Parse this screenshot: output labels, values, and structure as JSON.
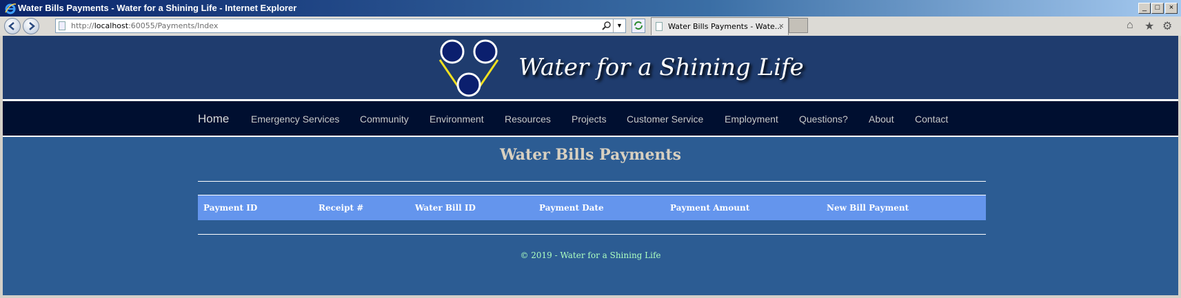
{
  "window": {
    "title": "Water Bills Payments - Water for a Shining Life - Internet Explorer",
    "buttons": [
      "_",
      "□",
      "×"
    ]
  },
  "browser": {
    "url_prefix": "http://",
    "url_host": "localhost",
    "url_rest": ":60055/Payments/Index",
    "tab_label": "Water Bills Payments - Wate...",
    "tab_close": "×",
    "tools": [
      "⌂",
      "★",
      "⚙"
    ]
  },
  "site": {
    "brand": "Water for a Shining Life",
    "nav": [
      "Home",
      "Emergency Services",
      "Community",
      "Environment",
      "Resources",
      "Projects",
      "Customer Service",
      "Employment",
      "Questions?",
      "About",
      "Contact"
    ]
  },
  "main": {
    "title": "Water Bills Payments",
    "columns": [
      "Payment ID",
      "Receipt #",
      "Water Bill ID",
      "Payment Date",
      "Payment Amount",
      "New Bill Payment"
    ]
  },
  "footer": {
    "text": "© 2019 - Water for a Shining Life"
  },
  "colors": {
    "header": "#1f3c6e",
    "nav": "#000f30",
    "body": "#2c5c93",
    "table_header": "#6495ed",
    "footer_text": "#adffc0"
  }
}
